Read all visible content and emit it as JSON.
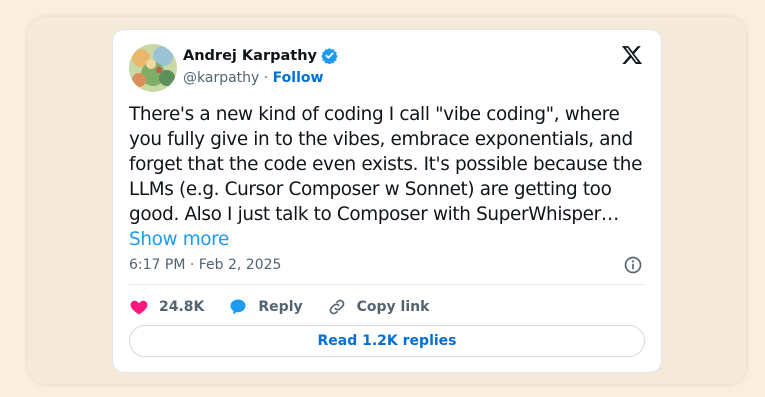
{
  "tweet": {
    "author_name": "Andrej Karpathy",
    "handle": "@karpathy",
    "separator": " · ",
    "follow_label": "Follow",
    "body": "There's a new kind of coding I call \"vibe coding\", where you fully give in to the vibes, embrace exponentials, and forget that the code even exists. It's possible because the LLMs (e.g. Cursor Composer w Sonnet) are getting too good. Also I just talk to Composer with SuperWhisper… ",
    "show_more_label": "Show more",
    "timestamp": "6:17 PM · Feb 2, 2025",
    "likes": "24.8K",
    "reply_label": "Reply",
    "copy_link_label": "Copy link",
    "read_replies_label": "Read 1.2K replies"
  },
  "icons": {
    "verified": "verified-badge-icon",
    "platform": "x-logo-icon",
    "info": "info-icon",
    "like": "heart-icon",
    "reply": "speech-bubble-icon",
    "copy_link": "link-icon"
  },
  "colors": {
    "accent_blue": "#1d9bf0",
    "link_blue": "#006fd6",
    "heart_pink": "#f91880",
    "muted_text": "#536471",
    "page_background": "#fbeee0"
  }
}
